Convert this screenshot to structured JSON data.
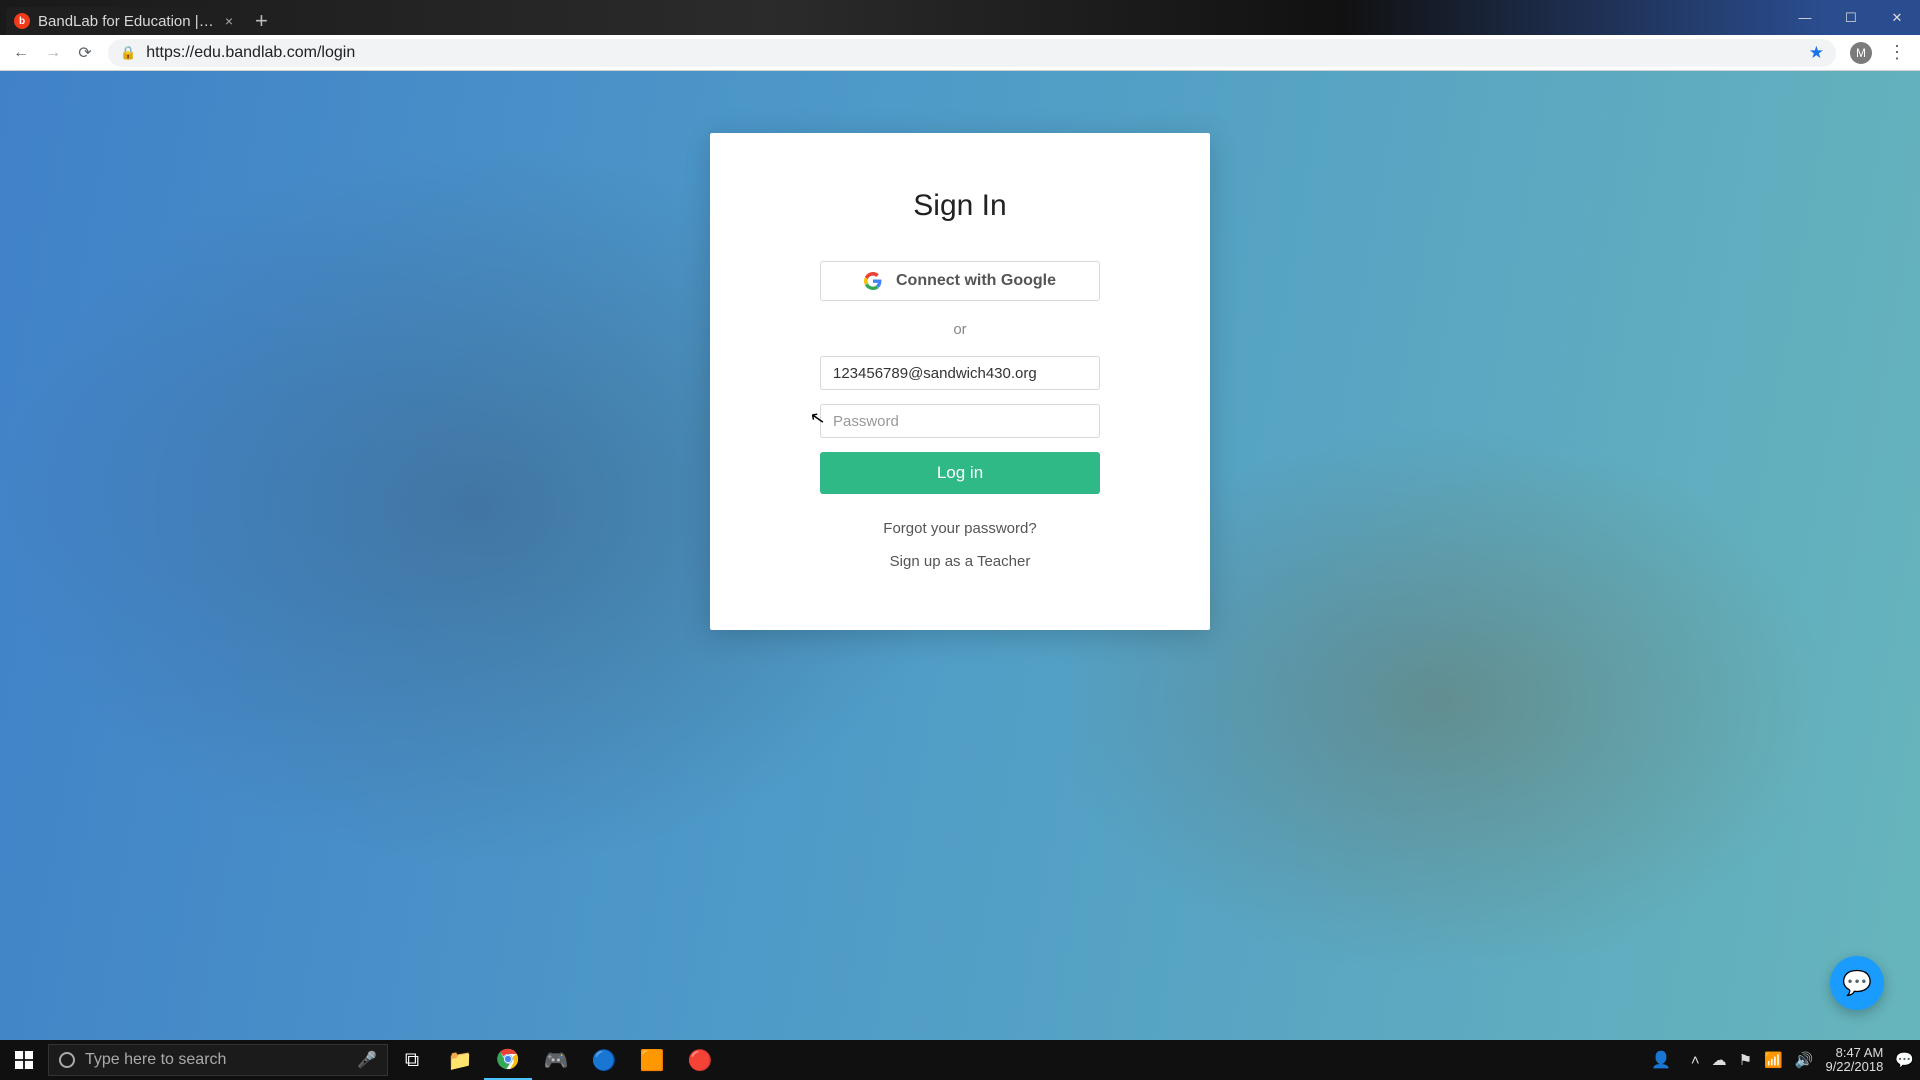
{
  "browser": {
    "tab_title": "BandLab for Education | FREE A…",
    "new_tab_label": "+",
    "url": "https://edu.bandlab.com/login",
    "profile_initial": "M",
    "favicon_letter": "b"
  },
  "window": {
    "minimize": "—",
    "maximize": "☐",
    "close": "✕"
  },
  "login": {
    "heading": "Sign In",
    "google_label": "Connect with Google",
    "or": "or",
    "email_value": "123456789@sandwich430.org",
    "password_placeholder": "Password",
    "submit_label": "Log in",
    "forgot_label": "Forgot your password?",
    "signup_label": "Sign up as a Teacher"
  },
  "taskbar": {
    "search_placeholder": "Type here to search",
    "time": "8:47 AM",
    "date": "9/22/2018"
  }
}
